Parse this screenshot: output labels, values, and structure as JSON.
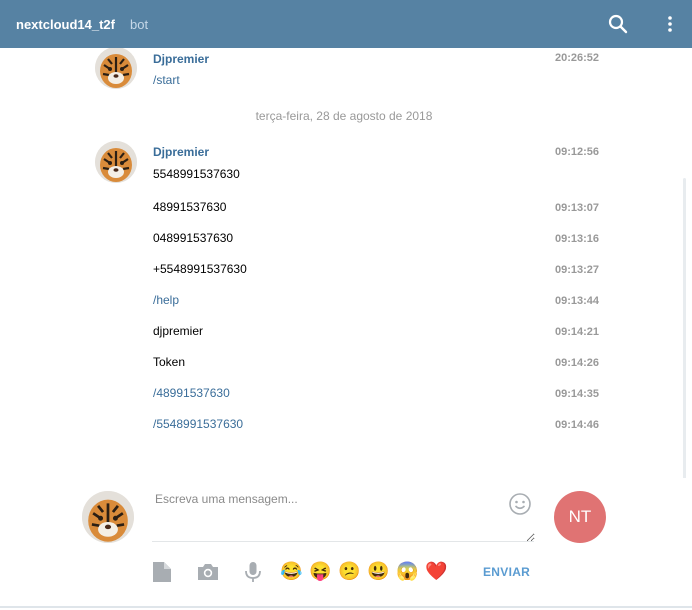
{
  "header": {
    "title": "nextcloud14_t2f",
    "subtitle": "bot",
    "background": "#5682a3"
  },
  "messages_top": {
    "author": "Djpremier",
    "text": "/start",
    "time": "20:26:52"
  },
  "date_separator": "terça-feira, 28 de agosto de 2018",
  "messages_day": {
    "author": "Djpremier",
    "items": [
      {
        "text": "5548991537630",
        "time": "09:12:56",
        "is_link": false
      },
      {
        "text": "48991537630",
        "time": "09:13:07",
        "is_link": false
      },
      {
        "text": "048991537630",
        "time": "09:13:16",
        "is_link": false
      },
      {
        "text": "+5548991537630",
        "time": "09:13:27",
        "is_link": false
      },
      {
        "text": "/help",
        "time": "09:13:44",
        "is_link": true
      },
      {
        "text": "djpremier",
        "time": "09:14:21",
        "is_link": false
      },
      {
        "text": "Token",
        "time": "09:14:26",
        "is_link": false
      },
      {
        "text": "/48991537630",
        "time": "09:14:35",
        "is_link": true
      },
      {
        "text": "/5548991537630",
        "time": "09:14:46",
        "is_link": true
      }
    ]
  },
  "compose": {
    "placeholder": "Escreva uma mensagem...",
    "value": "",
    "my_initials": "NT",
    "my_avatar_color": "#e07373",
    "send_label": "ENVIAR",
    "tools": [
      "file-icon",
      "camera-icon",
      "microphone-icon"
    ],
    "emojis": [
      "😂",
      "😝",
      "😕",
      "😃",
      "😱",
      "❤️"
    ]
  },
  "colors": {
    "link": "#3a6d99",
    "timestamp": "#999999",
    "send": "#5a9bd1"
  }
}
